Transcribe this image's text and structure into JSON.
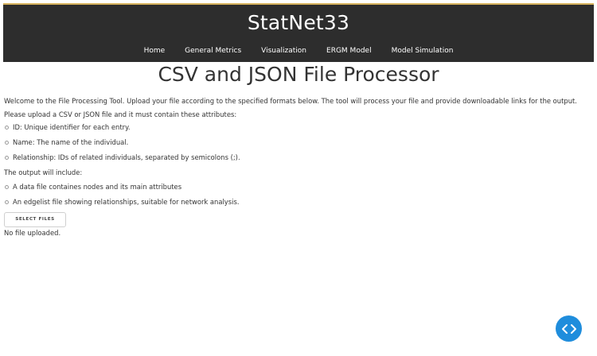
{
  "header": {
    "brand": "StatNet33",
    "nav": [
      {
        "label": "Home"
      },
      {
        "label": "General Metrics"
      },
      {
        "label": "Visualization"
      },
      {
        "label": "ERGM Model"
      },
      {
        "label": "Model Simulation"
      }
    ]
  },
  "main": {
    "title": "CSV and JSON File Processor",
    "welcome": "Welcome to the File Processing Tool. Upload your file according to the specified formats below. The tool will process your file and provide downloadable links for the output.",
    "upload_instructions": "Please upload a CSV or JSON file and it must contain these attributes:",
    "attributes": [
      "ID: Unique identifier for each entry.",
      "Name: The name of the individual.",
      "Relationship: IDs of related individuals, separated by semicolons (;)."
    ],
    "output_intro": "The output will include:",
    "outputs": [
      "A data file containes nodes and its main attributes",
      "An edgelist file showing relationships, suitable for network analysis."
    ],
    "select_button": "SELECT FILES",
    "status": "No file uploaded."
  },
  "fab": {
    "icon": "code-icon",
    "color": "#1f8ddc"
  },
  "colors": {
    "header_bg": "#2d2d2d",
    "header_accent": "#d6b25e",
    "text": "#333333"
  }
}
